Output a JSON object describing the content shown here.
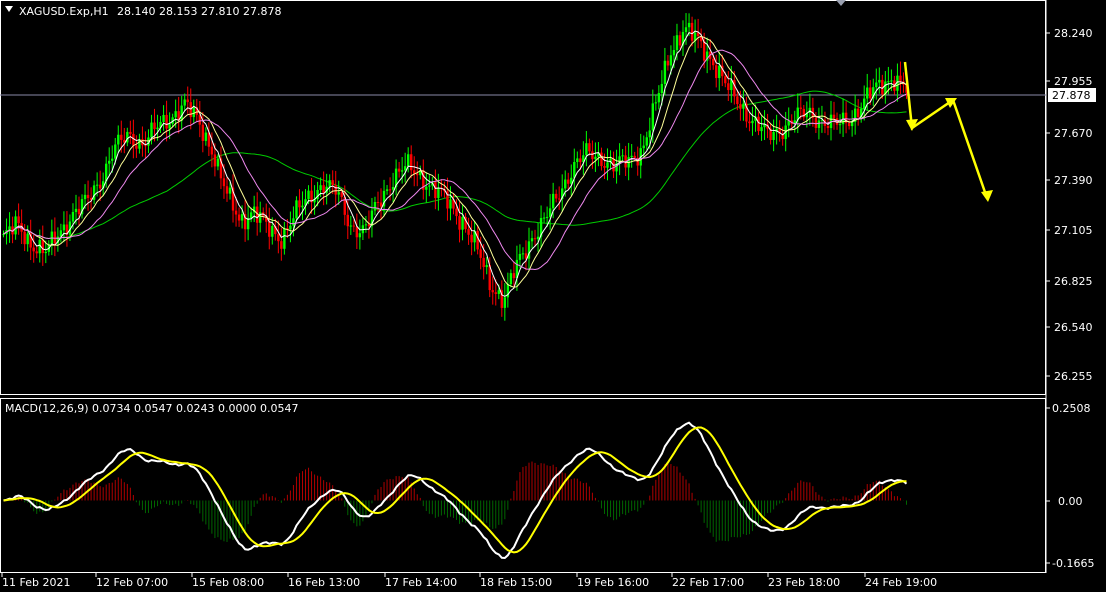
{
  "chart_data": {
    "type": "candlestick",
    "symbol_header": "XAGUSD.Exp,H1",
    "ohlc_header": "28.140 28.153 27.810 27.878",
    "current_price": "27.878",
    "price_ticks": [
      "28.240",
      "27.955",
      "27.670",
      "27.390",
      "27.105",
      "26.825",
      "26.540",
      "26.255"
    ],
    "price_range": [
      26.18,
      28.37
    ],
    "time_labels": [
      "11 Feb 2021",
      "12 Feb 07:00",
      "15 Feb 08:00",
      "16 Feb 13:00",
      "17 Feb 14:00",
      "18 Feb 15:00",
      "19 Feb 16:00",
      "22 Feb 17:00",
      "23 Feb 18:00",
      "24 Feb 19:00"
    ],
    "macd": {
      "header": "MACD(12,26,9) 0.0734 0.0547 0.0243 0.0000 0.0547",
      "ticks": [
        "0.2508",
        "0.00",
        "-0.1665"
      ],
      "range": [
        -0.185,
        0.26
      ]
    },
    "price_close": [
      27.05,
      27.12,
      27.02,
      26.96,
      27.08,
      27.18,
      27.25,
      27.38,
      27.55,
      27.62,
      27.58,
      27.66,
      27.72,
      27.8,
      27.7,
      27.55,
      27.3,
      27.15,
      27.2,
      27.1,
      27.05,
      27.18,
      27.28,
      27.35,
      27.3,
      27.12,
      27.08,
      27.25,
      27.38,
      27.45,
      27.4,
      27.32,
      27.25,
      27.15,
      27.0,
      26.8,
      26.7,
      26.9,
      27.05,
      27.15,
      27.3,
      27.45,
      27.52,
      27.5,
      27.45,
      27.48,
      27.55,
      27.8,
      28.1,
      28.22,
      28.15,
      28.05,
      27.9,
      27.8,
      27.7,
      27.62,
      27.66,
      27.72,
      27.75,
      27.7,
      27.68,
      27.72,
      27.82,
      27.9,
      27.95,
      27.878
    ],
    "colors": {
      "bull": "#00ff00",
      "bear": "#ff0000",
      "wick": "#c0c0c0",
      "ma_fast": "#ffffff",
      "ma_mid": "#ffff99",
      "ma_slow": "#ee88ee",
      "ma_long": "#00cc00",
      "forecast": "#ffff00",
      "macd_line": "#ffffff",
      "signal_line": "#ffff00",
      "hist_pos": "#b00000",
      "hist_neg": "#006600",
      "grid": "#ffffff"
    }
  }
}
